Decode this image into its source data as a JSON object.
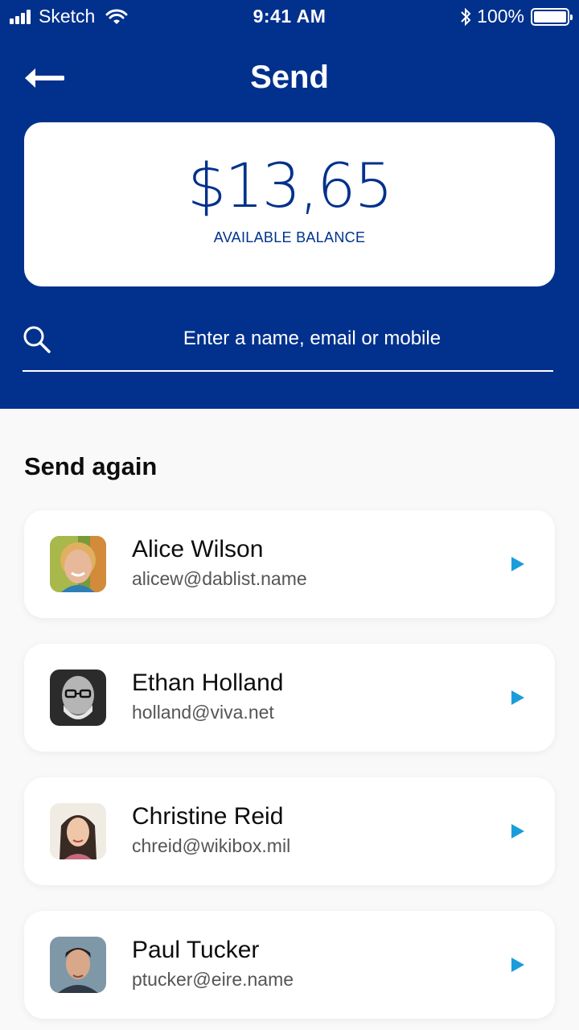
{
  "status_bar": {
    "carrier": "Sketch",
    "time": "9:41 AM",
    "battery": "100%",
    "icons": [
      "signal-icon",
      "wifi-icon",
      "bluetooth-icon",
      "battery-icon"
    ]
  },
  "nav": {
    "back_icon": "arrow-left-icon",
    "title": "Send"
  },
  "balance": {
    "amount": "$13,65",
    "label": "AVAILABLE BALANCE"
  },
  "search": {
    "icon": "search-icon",
    "placeholder": "Enter a name, email or mobile"
  },
  "send_again": {
    "title": "Send again",
    "contacts": [
      {
        "name": "Alice Wilson",
        "email": "alicew@dablist.name"
      },
      {
        "name": "Ethan Holland",
        "email": "holland@viva.net"
      },
      {
        "name": "Christine Reid",
        "email": "chreid@wikibox.mil"
      },
      {
        "name": "Paul Tucker",
        "email": "ptucker@eire.name"
      }
    ]
  },
  "colors": {
    "brand_blue": "#01318c",
    "accent_blue": "#1a9ddb",
    "background": "#f9f9f9"
  }
}
